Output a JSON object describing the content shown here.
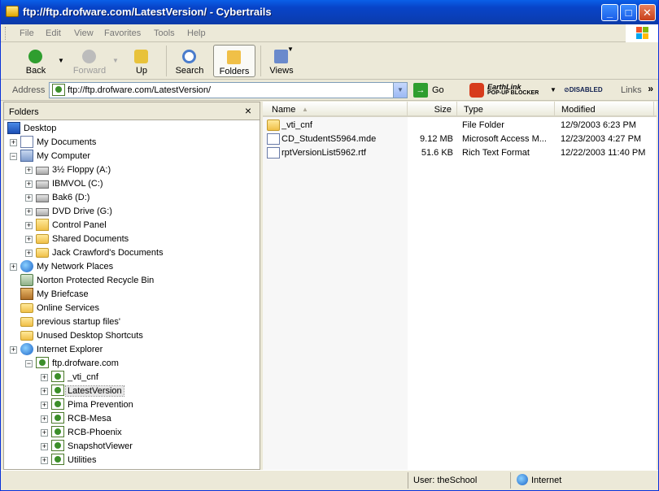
{
  "window": {
    "title": "ftp://ftp.drofware.com/LatestVersion/ - Cybertrails",
    "controls": {
      "minimize": "_",
      "maximize": "□",
      "close": "✕"
    }
  },
  "menu": [
    "File",
    "Edit",
    "View",
    "Favorites",
    "Tools",
    "Help"
  ],
  "toolbar": {
    "back": "Back",
    "forward": "Forward",
    "up": "Up",
    "search": "Search",
    "folders": "Folders",
    "views": "Views"
  },
  "address": {
    "label": "Address",
    "value": "ftp://ftp.drofware.com/LatestVersion/",
    "go": "Go"
  },
  "earthlink": {
    "top": "EarthLink",
    "bottom": "POP-UP BLOCKER",
    "status": "⊘DISABLED"
  },
  "links_label": "Links",
  "folders_pane": {
    "title": "Folders",
    "close": "×",
    "tree": [
      {
        "label": "Desktop",
        "icon": "desktop-icon",
        "expander": ""
      },
      {
        "label": "My Documents",
        "icon": "my-documents-icon",
        "expander": "+"
      },
      {
        "label": "My Computer",
        "icon": "my-computer-icon",
        "expander": "−"
      },
      {
        "label": "3½ Floppy (A:)",
        "icon": "floppy-drive-icon",
        "expander": "+"
      },
      {
        "label": "IBMVOL (C:)",
        "icon": "hard-drive-icon",
        "expander": "+"
      },
      {
        "label": "Bak6 (D:)",
        "icon": "hard-drive-icon",
        "expander": "+"
      },
      {
        "label": "DVD Drive (G:)",
        "icon": "dvd-drive-icon",
        "expander": "+"
      },
      {
        "label": "Control Panel",
        "icon": "control-panel-icon",
        "expander": "+"
      },
      {
        "label": "Shared Documents",
        "icon": "folder-icon",
        "expander": "+"
      },
      {
        "label": "Jack Crawford's Documents",
        "icon": "folder-icon",
        "expander": "+"
      },
      {
        "label": "My Network Places",
        "icon": "network-places-icon",
        "expander": "+"
      },
      {
        "label": "Norton Protected Recycle Bin",
        "icon": "recycle-bin-icon",
        "expander": ""
      },
      {
        "label": "My Briefcase",
        "icon": "briefcase-icon",
        "expander": ""
      },
      {
        "label": "Online Services",
        "icon": "folder-icon",
        "expander": ""
      },
      {
        "label": "previous startup files'",
        "icon": "folder-icon",
        "expander": ""
      },
      {
        "label": "Unused Desktop Shortcuts",
        "icon": "folder-icon",
        "expander": ""
      },
      {
        "label": "Internet Explorer",
        "icon": "internet-explorer-icon",
        "expander": "+"
      },
      {
        "label": "ftp.drofware.com",
        "icon": "ftp-site-icon",
        "expander": "−"
      },
      {
        "label": "_vti_cnf",
        "icon": "ftp-folder-icon",
        "expander": "+"
      },
      {
        "label": "LatestVersion",
        "icon": "ftp-folder-icon",
        "expander": "+"
      },
      {
        "label": "Pima Prevention",
        "icon": "ftp-folder-icon",
        "expander": "+"
      },
      {
        "label": "RCB-Mesa",
        "icon": "ftp-folder-icon",
        "expander": "+"
      },
      {
        "label": "RCB-Phoenix",
        "icon": "ftp-folder-icon",
        "expander": "+"
      },
      {
        "label": "SnapshotViewer",
        "icon": "ftp-folder-icon",
        "expander": "+"
      },
      {
        "label": "Utilities",
        "icon": "ftp-folder-icon",
        "expander": "+"
      }
    ]
  },
  "file_list": {
    "columns": [
      "Name",
      "Size",
      "Type",
      "Modified"
    ],
    "rows": [
      {
        "name": "_vti_cnf",
        "size": "",
        "type": "File Folder",
        "modified": "12/9/2003 6:23 PM",
        "icon": "folder-icon"
      },
      {
        "name": "CD_StudentS5964.mde",
        "size": "9.12 MB",
        "type": "Microsoft Access M...",
        "modified": "12/23/2003 4:27 PM",
        "icon": "access-file-icon"
      },
      {
        "name": "rptVersionList5962.rtf",
        "size": "51.6 KB",
        "type": "Rich Text Format",
        "modified": "12/22/2003 11:40 PM",
        "icon": "rtf-file-icon"
      }
    ]
  },
  "status": {
    "user": "User: theSchool",
    "zone": "Internet"
  }
}
